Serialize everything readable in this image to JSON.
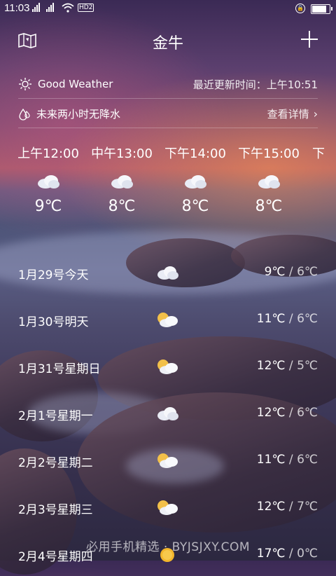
{
  "status_bar": {
    "time": "11:03",
    "network_labels": [
      "2G",
      "4G",
      "HD2"
    ],
    "battery_level": 0.9
  },
  "header": {
    "title": "金牛",
    "map_icon": "map-icon",
    "add_icon": "plus-icon"
  },
  "summary": {
    "condition_icon": "sun-icon",
    "condition": "Good Weather",
    "updated": "最近更新时间：上午10:51"
  },
  "precip": {
    "icon": "raindrop-icon",
    "text": "未来两小时无降水",
    "link": "查看详情"
  },
  "hourly": [
    {
      "time": "上午12:00",
      "temp": "9℃",
      "icon": "cloudy-icon"
    },
    {
      "time": "中午13:00",
      "temp": "8℃",
      "icon": "cloudy-icon"
    },
    {
      "time": "下午14:00",
      "temp": "8℃",
      "icon": "cloudy-icon"
    },
    {
      "time": "下午15:00",
      "temp": "8℃",
      "icon": "cloudy-icon"
    },
    {
      "time": "下",
      "temp": "",
      "icon": ""
    }
  ],
  "daily": [
    {
      "date": "1月29号今天",
      "high": "9℃",
      "sep": " / ",
      "low": "6℃",
      "icon": "cloudy-icon"
    },
    {
      "date": "1月30号明天",
      "high": "11℃",
      "sep": " / ",
      "low": "6℃",
      "icon": "partly-cloudy-icon"
    },
    {
      "date": "1月31号星期日",
      "high": "12℃",
      "sep": " / ",
      "low": "5℃",
      "icon": "partly-cloudy-icon"
    },
    {
      "date": "2月1号星期一",
      "high": "12℃",
      "sep": " / ",
      "low": "6℃",
      "icon": "cloudy-icon"
    },
    {
      "date": "2月2号星期二",
      "high": "11℃",
      "sep": " / ",
      "low": "6℃",
      "icon": "partly-cloudy-icon"
    },
    {
      "date": "2月3号星期三",
      "high": "12℃",
      "sep": " / ",
      "low": "7℃",
      "icon": "partly-cloudy-icon"
    },
    {
      "date": "2月4号星期四",
      "high": "17℃",
      "sep": " / ",
      "low": "0℃",
      "icon": "sunny-icon"
    }
  ],
  "watermark": "必用手机精选 · BYJSJXY.COM"
}
